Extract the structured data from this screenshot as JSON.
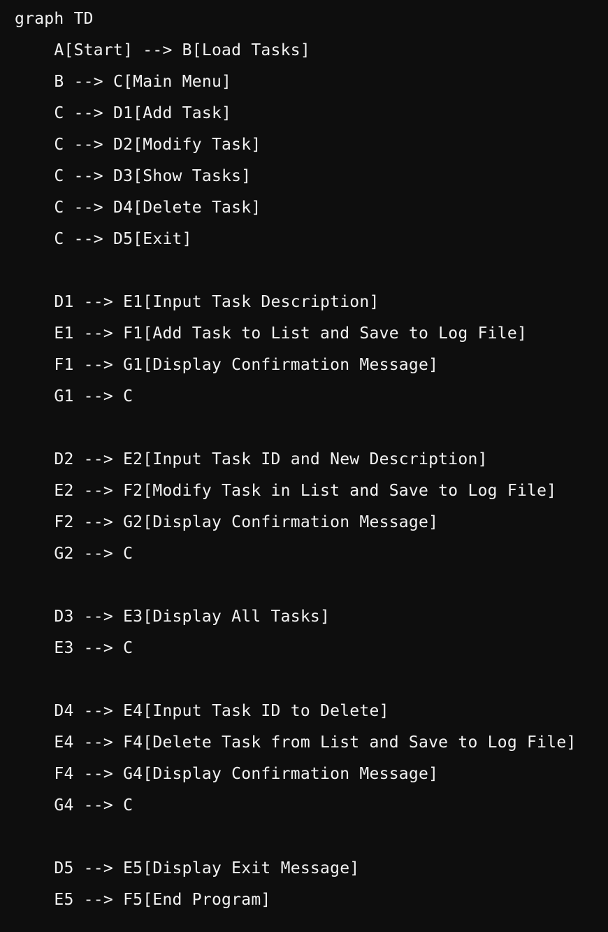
{
  "code": {
    "lines": [
      "graph TD",
      "    A[Start] --> B[Load Tasks]",
      "    B --> C[Main Menu]",
      "    C --> D1[Add Task]",
      "    C --> D2[Modify Task]",
      "    C --> D3[Show Tasks]",
      "    C --> D4[Delete Task]",
      "    C --> D5[Exit]",
      "",
      "    D1 --> E1[Input Task Description]",
      "    E1 --> F1[Add Task to List and Save to Log File]",
      "    F1 --> G1[Display Confirmation Message]",
      "    G1 --> C",
      "",
      "    D2 --> E2[Input Task ID and New Description]",
      "    E2 --> F2[Modify Task in List and Save to Log File]",
      "    F2 --> G2[Display Confirmation Message]",
      "    G2 --> C",
      "",
      "    D3 --> E3[Display All Tasks]",
      "    E3 --> C",
      "",
      "    D4 --> E4[Input Task ID to Delete]",
      "    E4 --> F4[Delete Task from List and Save to Log File]",
      "    F4 --> G4[Display Confirmation Message]",
      "    G4 --> C",
      "",
      "    D5 --> E5[Display Exit Message]",
      "    E5 --> F5[End Program]"
    ]
  }
}
